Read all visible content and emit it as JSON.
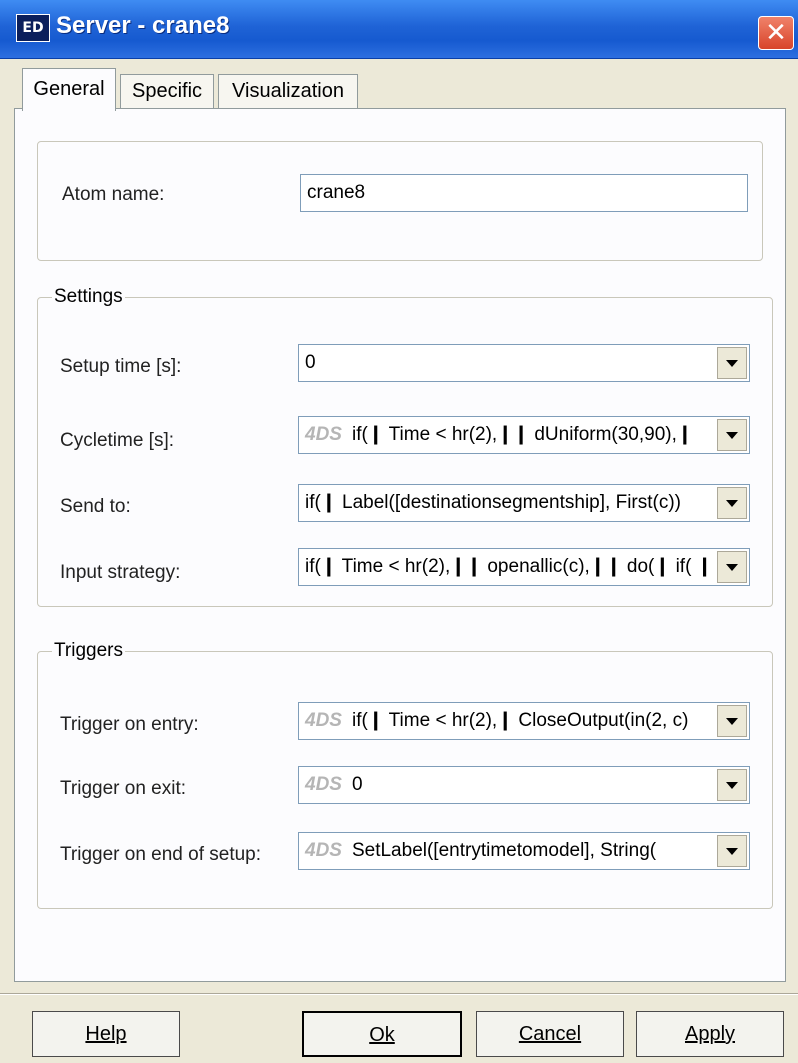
{
  "window": {
    "icon_text": "ED",
    "title": "Server - crane8",
    "close_icon": "close-x-icon"
  },
  "tabs": [
    {
      "label": "General",
      "active": true
    },
    {
      "label": "Specific",
      "active": false
    },
    {
      "label": "Visualization",
      "active": false
    }
  ],
  "atom": {
    "label": "Atom name:",
    "value": "crane8"
  },
  "settings": {
    "title": "Settings",
    "setup_time": {
      "label": "Setup time [s]:",
      "value": "0"
    },
    "cycletime": {
      "label": "Cycletime [s]:",
      "tag": "4DS",
      "value": "if(❙ Time < hr(2),❙❙ dUniform(30,90),❙"
    },
    "send_to": {
      "label": "Send to:",
      "value": "if(❙ Label([destinationsegmentship], First(c))"
    },
    "input_strategy": {
      "label": "Input strategy:",
      "value": "if(❙ Time < hr(2),❙❙ openallic(c),❙❙ do(❙  if( ❙"
    }
  },
  "triggers": {
    "title": "Triggers",
    "on_entry": {
      "label": "Trigger on entry:",
      "tag": "4DS",
      "value": "if(❙ Time < hr(2),❙ CloseOutput(in(2, c)"
    },
    "on_exit": {
      "label": "Trigger on exit:",
      "tag": "4DS",
      "value": "0"
    },
    "on_end_setup": {
      "label": "Trigger on end of setup:",
      "tag": "4DS",
      "value": "SetLabel([entrytimetomodel], String("
    }
  },
  "buttons": {
    "help": "Help",
    "ok": "Ok",
    "cancel": "Cancel",
    "apply": "Apply"
  }
}
